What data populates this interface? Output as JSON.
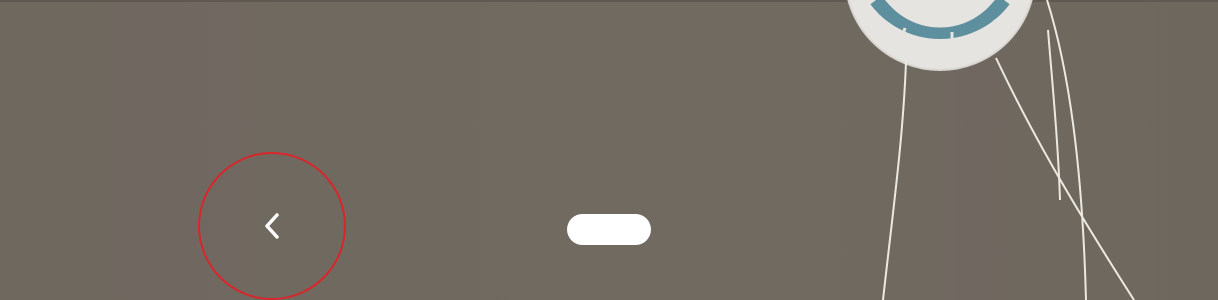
{
  "screen": {
    "background_color": "#706960",
    "highlight_color": "#d9262b"
  },
  "navigation_bar": {
    "back_button": {
      "icon": "chevron-left-icon",
      "highlighted": true
    },
    "home_button": {
      "icon": "home-pill-icon"
    }
  },
  "wallpaper": {
    "dial": {
      "outer_color": "#e4e3df",
      "ring_color": "#5e8f9e"
    },
    "strings_color": "#efece5"
  }
}
